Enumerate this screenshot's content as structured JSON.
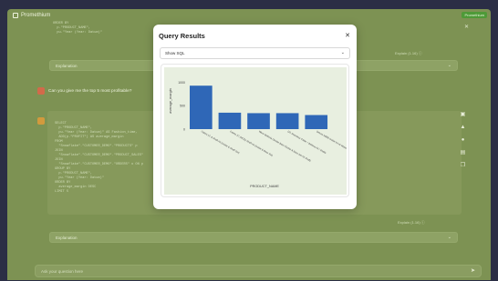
{
  "app": {
    "title": "Promethium",
    "top_badge": "Promethium"
  },
  "sql_snippet_1": "ORDER BY\n  p.\"PRODUCT_NAME\",\n  pu.\"Year (Year: Datum)\"",
  "sql_snippet_2": "SELECT\n  p.\"PRODUCT_NAME\",\n  pu.\"Year (Year: Datum)\" AS Fashion_time,\n  ADD(p.\"PROFIT\") AS average_margin\nFROM\n  \"Snowflake\".\"CUSTOMER_DEMO\".\"PRODUCTS\" p\nJOIN\n  \"Snowflake\".\"CUSTOMER_DEMO\".\"PRODUCT_SALES\"\nJOIN\n  \"Snowflake\".\"CUSTOMER_DEMO\".\"ORDERS\" o ON p\nGROUP BY\n  p.\"PRODUCT_NAME\",\n  pu.\"Year (Year: Datum)\"\nORDER BY\n  average_margin DESC\nLIMIT 5",
  "explain_label_1": "Explain (1.16) ⓘ",
  "explain_label_2": "Explain (1.16) ⓘ",
  "explanation_select_1": "Explanation",
  "explanation_select_2": "Explanation",
  "user_message": "Can you give me the top 5 most profitable?",
  "chat_input_placeholder": "Ask your question here",
  "icons": [
    "close-icon",
    "save-icon",
    "warning-icon",
    "bulb-icon",
    "chart-icon",
    "copy-icon",
    "send-icon"
  ],
  "modal": {
    "title": "Query Results",
    "sql_toggle": "Show SQL"
  },
  "chart_data": {
    "type": "bar",
    "categories": [
      "Cabrio 1C & Shaft Kit (Guitar & Shaft Set)",
      "Cabrio 1C (MOD) Shaft Kit (Guitar & Bass Set)",
      "Wave Bellonia Double Bass (Guitar & Bass Set Kit Shaft)",
      "DG Seamless Cable + Bellona Kit / Shafts",
      "Deluxe ABBB Guitar Kit w/ Wood & Ad"
    ],
    "values": [
      1850,
      700,
      680,
      680,
      600
    ],
    "xlabel": "PRODUCT_NAME",
    "ylabel": "average_margin",
    "yticks": [
      "0",
      "500",
      "1000"
    ],
    "ytick_values": [
      0,
      1000,
      2000
    ],
    "ylim": [
      0,
      2400
    ],
    "bar_color": "#2f67b7",
    "plot_bg": "#e8efe0",
    "grid": false
  }
}
